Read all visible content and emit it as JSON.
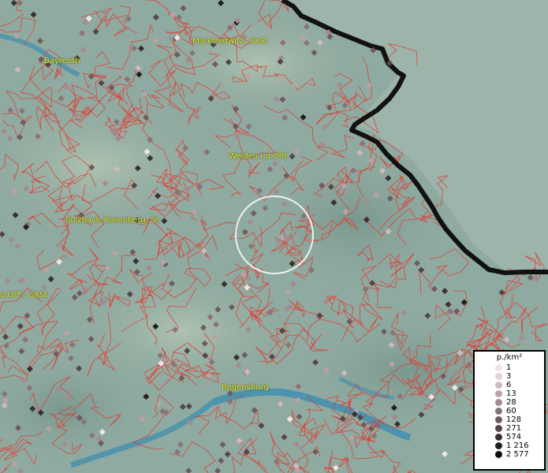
{
  "map": {
    "place_labels": [
      {
        "id": "marktredwitz",
        "text": "Marktredwitz, GKSt"
      },
      {
        "id": "bayreuth",
        "text": "Bayreuth"
      },
      {
        "id": "weiden",
        "text": "Weiden i.d.OPf."
      },
      {
        "id": "sulzbach",
        "text": "Sulzbach-Rosenberg, St"
      },
      {
        "id": "opf",
        "text": "d.OPf., GKSt"
      },
      {
        "id": "regensburg",
        "text": "Regensburg"
      }
    ],
    "colors": {
      "terrain": "#8faaa0",
      "water": "#3f8fb0",
      "boundary_lines": "#e8322a",
      "national_border": "#111111",
      "label_text": "#e3e82a",
      "selection_circle": "#ffffff"
    }
  },
  "legend": {
    "title": "p./km²",
    "entries": [
      {
        "label": "1",
        "color": "#f3e4e4"
      },
      {
        "label": "3",
        "color": "#e6d0d2"
      },
      {
        "label": "6",
        "color": "#d2b8bc"
      },
      {
        "label": "13",
        "color": "#bca2a6"
      },
      {
        "label": "28",
        "color": "#a48b90"
      },
      {
        "label": "60",
        "color": "#8a7478"
      },
      {
        "label": "128",
        "color": "#6e5c60"
      },
      {
        "label": "271",
        "color": "#534548"
      },
      {
        "label": "574",
        "color": "#3a3032"
      },
      {
        "label": "1 216",
        "color": "#241d1e"
      },
      {
        "label": "2 577",
        "color": "#0d0a0b"
      }
    ]
  }
}
